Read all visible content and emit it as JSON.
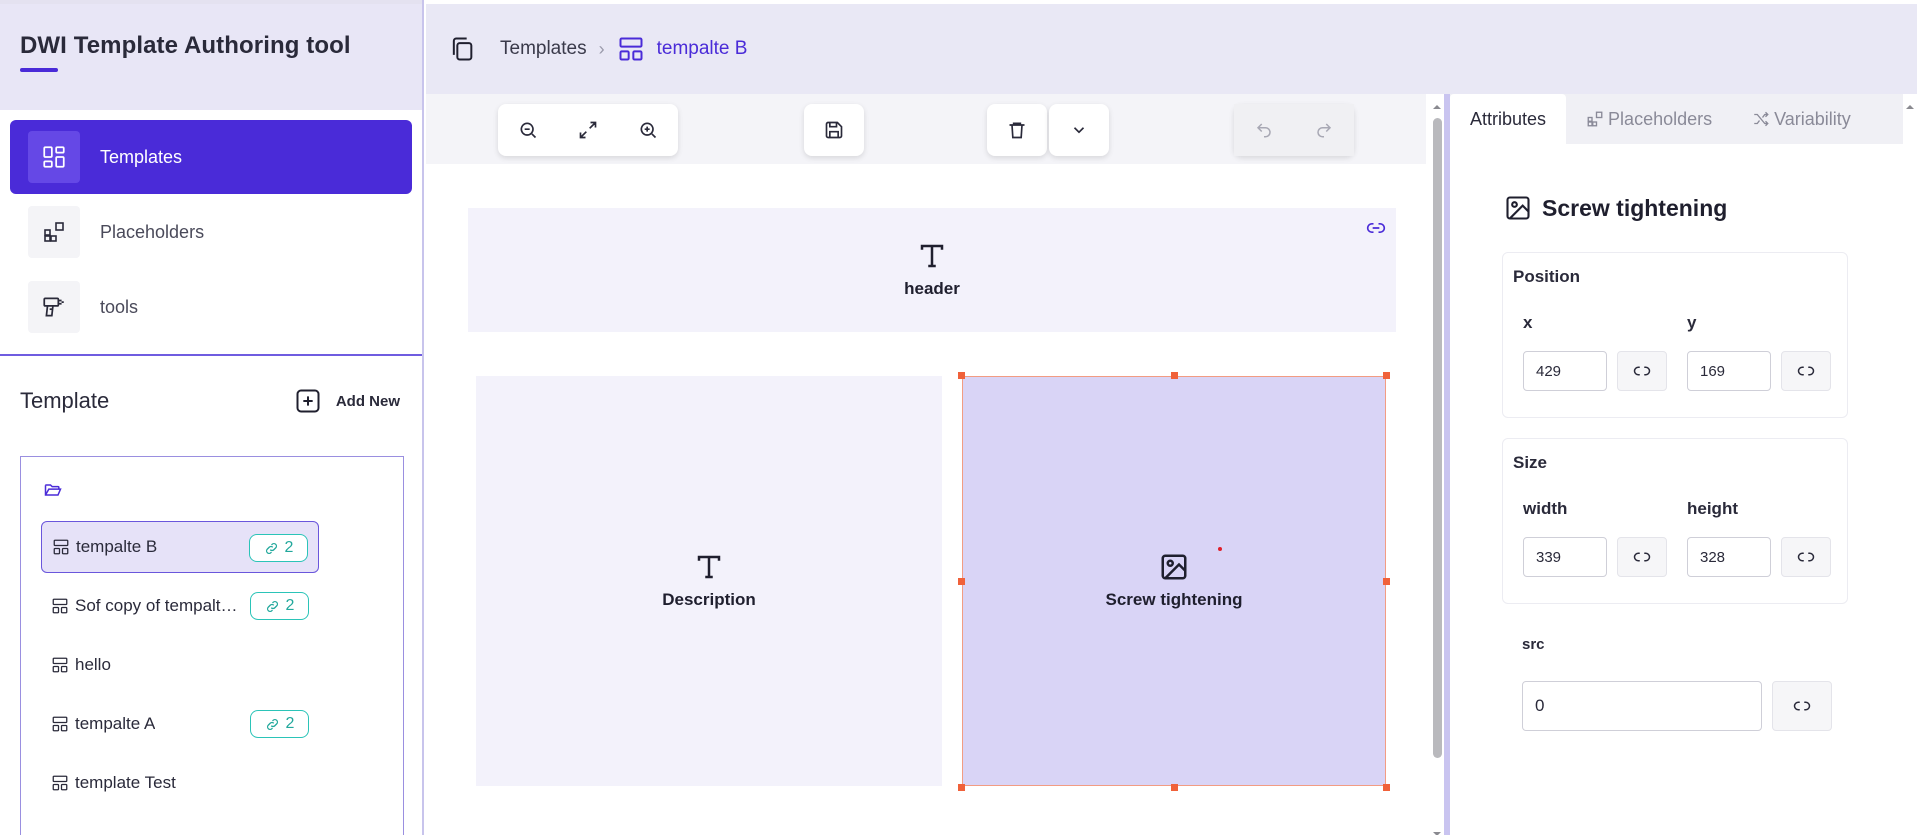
{
  "app": {
    "title": "DWI Template Authoring tool"
  },
  "sidebar": {
    "nav": [
      {
        "label": "Templates",
        "icon": "layout-dashboard-icon",
        "active": true
      },
      {
        "label": "Placeholders",
        "icon": "blocks-icon",
        "active": false
      },
      {
        "label": "tools",
        "icon": "drill-icon",
        "active": false
      }
    ],
    "template_section": {
      "title": "Template",
      "add_label": "Add New"
    },
    "templates": [
      {
        "label": "tempalte B",
        "links": "2",
        "selected": true
      },
      {
        "label": "Sof copy of tempalte B",
        "links": "2",
        "selected": false
      },
      {
        "label": "hello",
        "links": "",
        "selected": false
      },
      {
        "label": "tempalte A",
        "links": "2",
        "selected": false
      },
      {
        "label": "template Test",
        "links": "",
        "selected": false
      }
    ]
  },
  "breadcrumb": {
    "root": "Templates",
    "current": "tempalte B"
  },
  "toolbar": {
    "groups": [
      [
        "zoom-out-icon",
        "fit-screen-icon",
        "zoom-in-icon"
      ],
      [
        "save-icon"
      ],
      [
        "delete-icon",
        "chevron-down-icon"
      ],
      [
        "undo-icon",
        "redo-icon"
      ]
    ]
  },
  "canvas": {
    "blocks": [
      {
        "name": "header",
        "label": "header",
        "type": "text"
      },
      {
        "name": "description",
        "label": "Description",
        "type": "text"
      },
      {
        "name": "screw-tightening",
        "label": "Screw tightening",
        "type": "image",
        "selected": true
      }
    ]
  },
  "panel": {
    "tabs": [
      {
        "label": "Attributes",
        "active": true
      },
      {
        "label": "Placeholders",
        "active": false
      },
      {
        "label": "Variability",
        "active": false
      }
    ],
    "title": "Screw tightening",
    "position": {
      "title": "Position",
      "x_label": "x",
      "x_value": "429",
      "y_label": "y",
      "y_value": "169"
    },
    "size": {
      "title": "Size",
      "w_label": "width",
      "w_value": "339",
      "h_label": "height",
      "h_value": "328"
    },
    "src": {
      "label": "src",
      "value": "0"
    }
  },
  "colors": {
    "accent": "#4a2bd8",
    "selection": "#f0613a",
    "link_badge": "#2bc4b8",
    "selected_block": "#d9d4f6"
  }
}
